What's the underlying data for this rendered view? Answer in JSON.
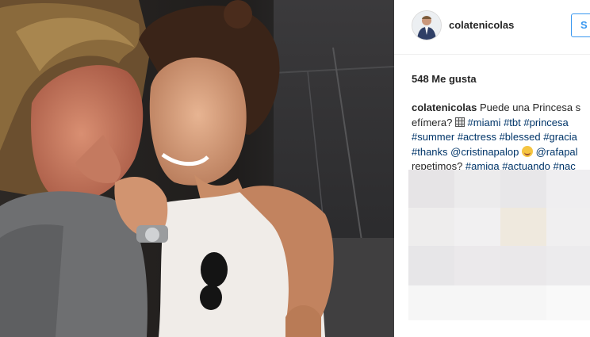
{
  "post": {
    "photo_alt": "",
    "header": {
      "username": "colatenicolas",
      "follow_label": "S"
    },
    "likes_text": "548 Me gusta",
    "caption": {
      "author": "colatenicolas",
      "line1_text": " Puede una Princesa s",
      "line2_text": "efímera? ",
      "line2_tags": [
        "#miami",
        "#tbt",
        "#princesa"
      ],
      "line3_tags": [
        "#summer",
        "#actress",
        "#blessed",
        "#gracia"
      ],
      "line4_lead_tag": "#thanks",
      "line4_mentions": [
        "@cristinapalop",
        "@rafapal"
      ],
      "line5_text": "repetimos? ",
      "line5_tags": [
        "#amiga",
        "#actuando",
        "#nac"
      ]
    },
    "icons": {
      "grid_emoji": "calendar-grid-icon",
      "smile_emoji": "smiling-face-icon"
    },
    "colors": {
      "link": "#003569",
      "follow": "#3897f0",
      "text": "#262626",
      "divider": "#efefef"
    }
  }
}
